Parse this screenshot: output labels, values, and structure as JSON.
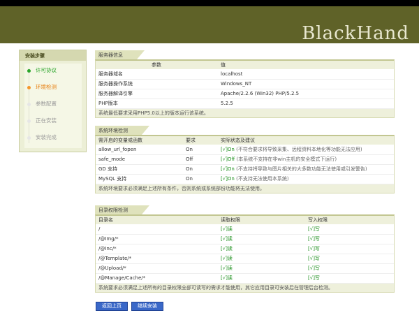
{
  "brand": "BlackHand",
  "sidebar": {
    "title": "安装步骤",
    "steps": [
      {
        "label": "许可协议",
        "state": "done"
      },
      {
        "label": "环境检测",
        "state": "current"
      },
      {
        "label": "参数配置",
        "state": "pending"
      },
      {
        "label": "正在安装",
        "state": "pending"
      },
      {
        "label": "安装完成",
        "state": "pending"
      }
    ]
  },
  "server_info": {
    "title": "服务器信息",
    "headers": [
      "参数",
      "值"
    ],
    "rows": [
      [
        "服务器域名",
        "localhost"
      ],
      [
        "服务器操作系统",
        "Windows_NT"
      ],
      [
        "服务器解译引擎",
        "Apache/2.2.6 (Win32) PHP/5.2.5"
      ],
      [
        "PHP版本",
        "5.2.5"
      ]
    ],
    "footnote": "系统最低要求采用PHP5.0以上的版本运行该系统。"
  },
  "env_check": {
    "title": "系统环境检测",
    "headers": [
      "需开启的变量或函数",
      "要求",
      "实际状态及建议"
    ],
    "rows": [
      {
        "name": "allow_url_fopen",
        "req": "On",
        "status": "[√]On",
        "hint": "(不符合要求将导致采集、远程资料本地化等功能无法应用)"
      },
      {
        "name": "safe_mode",
        "req": "Off",
        "status": "[√]Off",
        "hint": "(本系统不支持在非win主机的安全模式下运行)"
      },
      {
        "name": "GD 支持",
        "req": "On",
        "status": "[√]On",
        "hint": "(不支持将导致与图片相关的大多数功能无法使用或引发警告)"
      },
      {
        "name": "MySQL 支持",
        "req": "On",
        "status": "[√]On",
        "hint": "(不支持无法使用本系统)"
      }
    ],
    "footnote": "系统环境要求必须满足上述所有条件，否则系统或系统部份功能将无法使用。"
  },
  "dir_check": {
    "title": "目录权限检测",
    "headers": [
      "目录名",
      "读取权限",
      "写入权限"
    ],
    "rows": [
      [
        "/",
        "[√]读",
        "[√]写"
      ],
      [
        "/@Img/*",
        "[√]读",
        "[√]写"
      ],
      [
        "/@Inc/*",
        "[√]读",
        "[√]写"
      ],
      [
        "/@Template/*",
        "[√]读",
        "[√]写"
      ],
      [
        "/@Upload/*",
        "[√]读",
        "[√]写"
      ],
      [
        "/@Manage/Cache/*",
        "[√]读",
        "[√]写"
      ]
    ],
    "footnote": "系统要求必须满足上述所有的目录权限全部可读写的需求才能使用，其它应用目录可安装后在管理后台检测。"
  },
  "buttons": {
    "back": "返回上页",
    "next": "继续安装"
  }
}
